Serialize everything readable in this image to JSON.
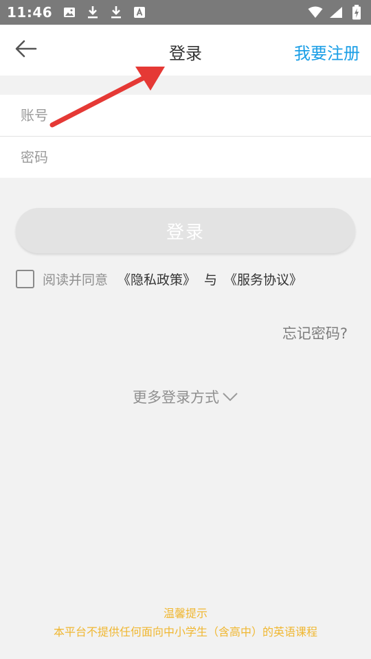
{
  "status_bar": {
    "time": "11:46",
    "left_icons": [
      "image-icon",
      "download-icon",
      "download-icon",
      "font-app-icon"
    ],
    "right_icons": [
      "wifi-icon",
      "signal-icon",
      "battery-charging-icon"
    ]
  },
  "header": {
    "back_icon": "arrow-left-icon",
    "title": "登录",
    "register_label": "我要注册"
  },
  "form": {
    "account_placeholder": "账号",
    "account_value": "",
    "password_placeholder": "密码",
    "password_value": ""
  },
  "login_button_label": "登录",
  "agreement": {
    "checked": false,
    "prefix": "阅读并同意",
    "privacy_link": "《隐私政策》",
    "and": "与",
    "service_link": "《服务协议》"
  },
  "forgot_password_label": "忘记密码?",
  "more_login_label": "更多登录方式",
  "tip": {
    "title": "温馨提示",
    "text": "本平台不提供任何面向中小学生（含高中）的英语课程"
  },
  "colors": {
    "accent": "#1a9ee6",
    "tip": "#f0b731",
    "annotation_arrow": "#e53935"
  }
}
